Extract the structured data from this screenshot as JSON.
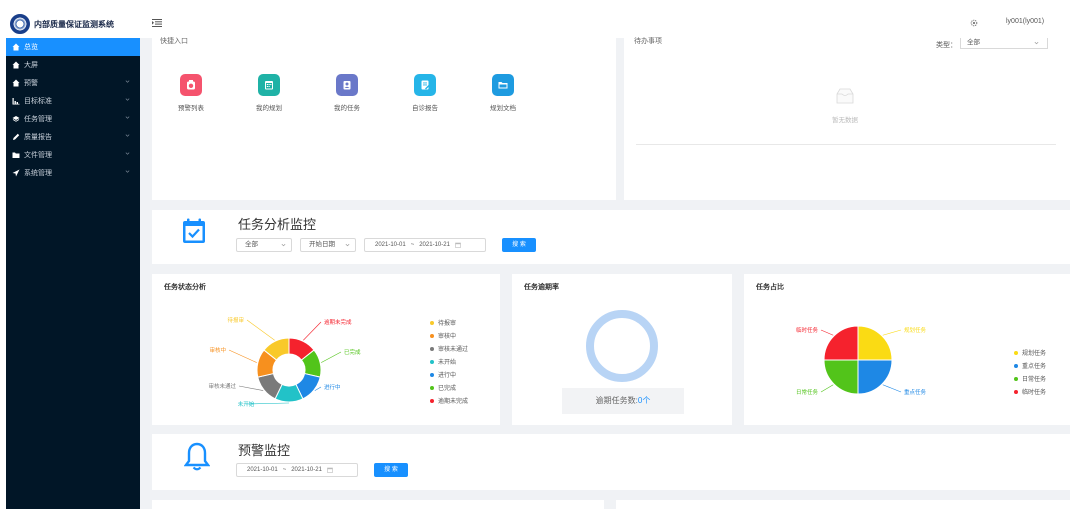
{
  "app": {
    "title": "内部质量保证监测系统"
  },
  "sidebar": {
    "items": [
      {
        "label": "总览",
        "icon": "home-icon",
        "active": true,
        "has_children": false
      },
      {
        "label": "大屏",
        "icon": "home-icon",
        "active": false,
        "has_children": false
      },
      {
        "label": "预警",
        "icon": "home-icon",
        "active": false,
        "has_children": true
      },
      {
        "label": "目标标准",
        "icon": "bar-chart-icon",
        "active": false,
        "has_children": true
      },
      {
        "label": "任务管理",
        "icon": "layers-icon",
        "active": false,
        "has_children": true
      },
      {
        "label": "质量报告",
        "icon": "pen-icon",
        "active": false,
        "has_children": true
      },
      {
        "label": "文件管理",
        "icon": "folder-icon",
        "active": false,
        "has_children": true
      },
      {
        "label": "系统管理",
        "icon": "send-icon",
        "active": false,
        "has_children": true
      }
    ]
  },
  "header": {
    "user": "ly001(ly001)"
  },
  "quick": {
    "title": "快捷入口",
    "items": [
      {
        "label": "预警列表",
        "color": "#f5536d",
        "icon": "alarm-icon"
      },
      {
        "label": "我的规划",
        "color": "#1fb2a6",
        "icon": "calendar-icon"
      },
      {
        "label": "我的任务",
        "color": "#6a78c9",
        "icon": "task-icon"
      },
      {
        "label": "自诊报告",
        "color": "#26b5e8",
        "icon": "report-icon"
      },
      {
        "label": "规划文档",
        "color": "#1e9be0",
        "icon": "folder-icon"
      }
    ]
  },
  "todo": {
    "title": "待办事项",
    "type_label": "类型：",
    "type_value": "全部",
    "empty_text": "暂无数据"
  },
  "task_monitor": {
    "title": "任务分析监控",
    "filter_all": "全部",
    "filter_date_type": "开始日期",
    "date_start": "2021-10-01",
    "date_sep": "~",
    "date_end": "2021-10-21",
    "search_label": "搜 索"
  },
  "task_status": {
    "title": "任务状态分析",
    "slice_labels": [
      "待报审",
      "逾期未完成",
      "已完成",
      "进行中",
      "未开始",
      "审核未通过",
      "审核中"
    ],
    "legend": [
      {
        "label": "待报审",
        "color": "#f9c92a"
      },
      {
        "label": "审核中",
        "color": "#f7901e"
      },
      {
        "label": "审核未通过",
        "color": "#7a7a7a"
      },
      {
        "label": "未开始",
        "color": "#22c2c8"
      },
      {
        "label": "进行中",
        "color": "#1e88e5"
      },
      {
        "label": "已完成",
        "color": "#52c41a"
      },
      {
        "label": "逾期未完成",
        "color": "#f5222d"
      }
    ]
  },
  "overdue": {
    "title": "任务逾期率",
    "text": "逾期任务数:",
    "count": "0个",
    "ring_color": "#b8d4f5"
  },
  "task_ratio": {
    "title": "任务占比",
    "slice_labels": [
      "临时任务",
      "规划任务",
      "重点任务",
      "日常任务"
    ],
    "legend": [
      {
        "label": "规划任务",
        "color": "#fadb14"
      },
      {
        "label": "重点任务",
        "color": "#1e88e5"
      },
      {
        "label": "日常任务",
        "color": "#52c41a"
      },
      {
        "label": "临时任务",
        "color": "#f5222d"
      }
    ]
  },
  "warn_monitor": {
    "title": "预警监控",
    "date_start": "2021-10-01",
    "date_sep": "~",
    "date_end": "2021-10-21",
    "search_label": "搜 索"
  }
}
